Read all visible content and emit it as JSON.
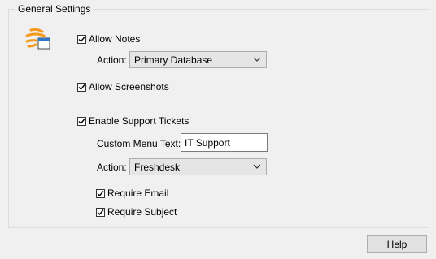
{
  "group": {
    "title": "General Settings"
  },
  "icons": {
    "app": "settings-window-icon",
    "check": "check-icon",
    "chevron": "chevron-down-icon"
  },
  "notes": {
    "checkbox_label": "Allow Notes",
    "checked": true,
    "action_label": "Action:",
    "action_value": "Primary Database"
  },
  "screenshots": {
    "checkbox_label": "Allow Screenshots",
    "checked": true
  },
  "tickets": {
    "checkbox_label": "Enable Support Tickets",
    "checked": true,
    "menu_text_label": "Custom Menu Text:",
    "menu_text_value": "IT Support",
    "action_label": "Action:",
    "action_value": "Freshdesk",
    "require_email_label": "Require Email",
    "require_email_checked": true,
    "require_subject_label": "Require Subject",
    "require_subject_checked": true
  },
  "footer": {
    "help_label": "Help"
  },
  "colors": {
    "icon_orange": "#f39a1e",
    "icon_blue": "#2e78c7"
  }
}
